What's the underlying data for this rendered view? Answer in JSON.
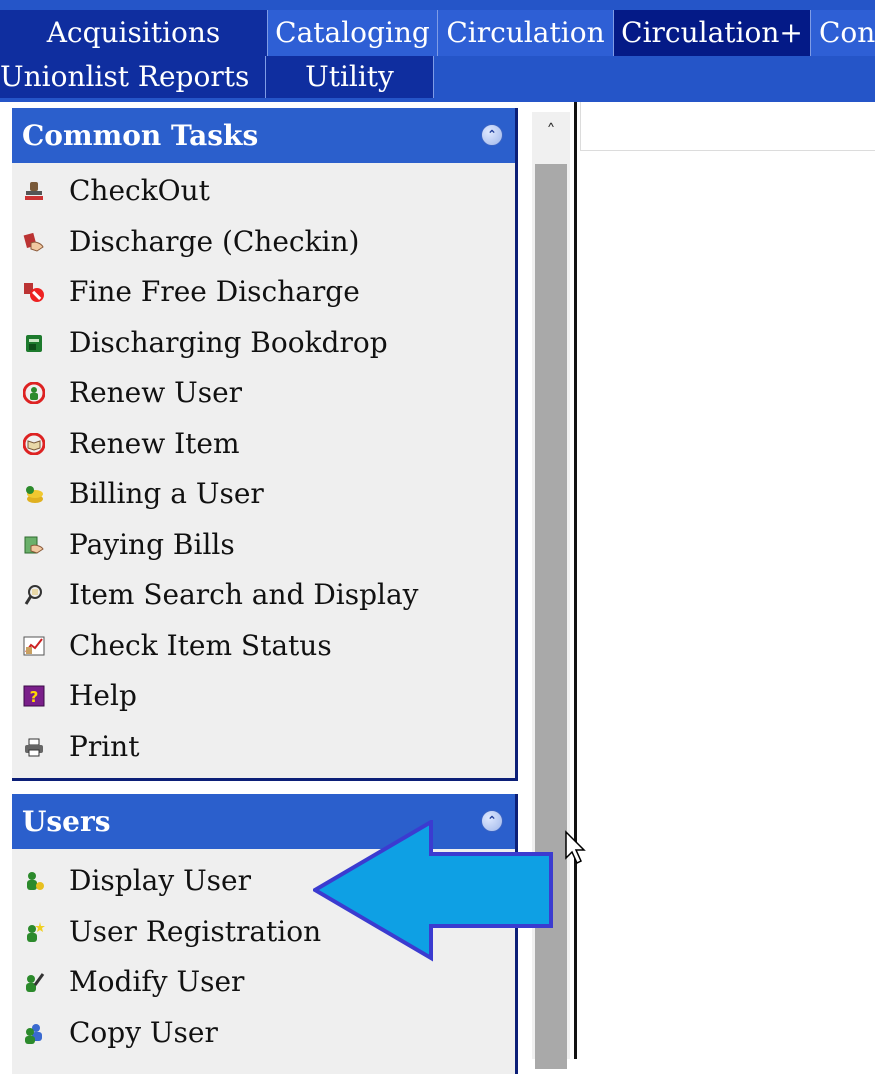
{
  "menu": {
    "tabs": [
      "Acquisitions",
      "Cataloging",
      "Circulation",
      "Circulation+",
      "Con"
    ],
    "tabs_row2": [
      "Unionlist Reports",
      "Utility"
    ],
    "selected_tab": "Circulation+"
  },
  "common_tasks": {
    "title": "Common Tasks",
    "items": [
      {
        "label": "CheckOut",
        "icon": "stamp-icon"
      },
      {
        "label": "Discharge (Checkin)",
        "icon": "hand-book-icon"
      },
      {
        "label": "Fine Free Discharge",
        "icon": "no-fine-icon"
      },
      {
        "label": "Discharging Bookdrop",
        "icon": "bookdrop-icon"
      },
      {
        "label": "Renew User",
        "icon": "renew-user-icon"
      },
      {
        "label": "Renew Item",
        "icon": "renew-item-icon"
      },
      {
        "label": "Billing a User",
        "icon": "billing-icon"
      },
      {
        "label": "Paying Bills",
        "icon": "paying-bills-icon"
      },
      {
        "label": "Item Search and Display",
        "icon": "item-search-icon"
      },
      {
        "label": "Check Item Status",
        "icon": "item-status-icon"
      },
      {
        "label": "Help",
        "icon": "help-icon"
      },
      {
        "label": "Print",
        "icon": "print-icon"
      }
    ]
  },
  "users": {
    "title": "Users",
    "items": [
      {
        "label": "Display User",
        "icon": "display-user-icon"
      },
      {
        "label": "User Registration",
        "icon": "user-registration-icon"
      },
      {
        "label": "Modify User",
        "icon": "modify-user-icon"
      },
      {
        "label": "Copy User",
        "icon": "copy-user-icon"
      }
    ]
  },
  "colors": {
    "menu_bar": "#2555c8",
    "selected_tab": "#041a87",
    "panel_header": "#2b5fcc",
    "panel_body": "#efefef",
    "arrow": "#0ea0e4"
  }
}
